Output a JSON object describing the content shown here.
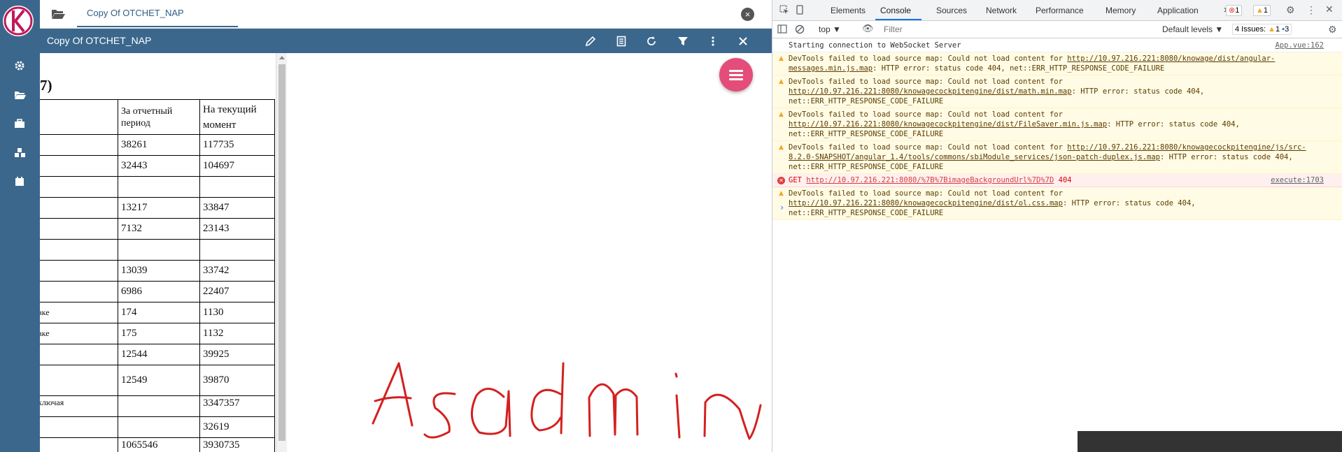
{
  "tab": {
    "label": "Copy Of OTCHET_NAP"
  },
  "toolbar": {
    "title": "Copy Of OTCHET_NAP"
  },
  "document": {
    "title_fragment": "7)",
    "table": {
      "headers": [
        "",
        "За отчетный период",
        "На текущий момент"
      ],
      "rows": [
        [
          "",
          "38261",
          "117735"
        ],
        [
          "",
          "32443",
          "104697"
        ],
        [
          "",
          "",
          ""
        ],
        [
          "",
          "13217",
          "33847"
        ],
        [
          "",
          "7132",
          "23143"
        ],
        [
          "",
          "",
          ""
        ],
        [
          "",
          "13039",
          "33742"
        ],
        [
          "",
          "6986",
          "22407"
        ],
        [
          "вке",
          "174",
          "1130"
        ],
        [
          "вке",
          "175",
          "1132"
        ],
        [
          "",
          "12544",
          "39925"
        ],
        [
          "",
          "12549",
          "39870"
        ],
        [
          "ключая",
          "",
          "3347357"
        ],
        [
          "",
          "",
          "32619"
        ],
        [
          "",
          "1065546",
          "3930735"
        ]
      ]
    },
    "handwriting": "Asadmin"
  },
  "devtools": {
    "tabs": [
      "Elements",
      "Console",
      "Sources",
      "Network",
      "Performance",
      "Memory",
      "Application"
    ],
    "active_tab": "Console",
    "more": "»",
    "error_badge": "1",
    "warning_badge": "1",
    "context": "top ▼",
    "filter_placeholder": "Filter",
    "levels": "Default levels ▼",
    "issues_label": "4 Issues:",
    "issues_warn": "1",
    "issues_info": "3",
    "messages": [
      {
        "type": "info",
        "text": "Starting connection to WebSocket Server",
        "source": "App.vue:162"
      },
      {
        "type": "warn",
        "text": "DevTools failed to load source map: Could not load content for ",
        "link": "http://10.97.216.221:8080/knowage/dist/angular-messages.min.js.map",
        "suffix": ": HTTP error: status code 404, net::ERR_HTTP_RESPONSE_CODE_FAILURE"
      },
      {
        "type": "warn",
        "text": "DevTools failed to load source map: Could not load content for ",
        "link": "http://10.97.216.221:8080/knowagecockpitengine/dist/math.min.map",
        "suffix": ": HTTP error: status code 404, net::ERR_HTTP_RESPONSE_CODE_FAILURE"
      },
      {
        "type": "warn",
        "text": "DevTools failed to load source map: Could not load content for ",
        "link": "http://10.97.216.221:8080/knowagecockpitengine/dist/FileSaver.min.js.map",
        "suffix": ": HTTP error: status code 404, net::ERR_HTTP_RESPONSE_CODE_FAILURE"
      },
      {
        "type": "warn",
        "text": "DevTools failed to load source map: Could not load content for ",
        "link": "http://10.97.216.221:8080/knowagecockpitengine/js/src-8.2.0-SNAPSHOT/angular_1.4/tools/commons/sbiModule_services/json-patch-duplex.js.map",
        "suffix": ": HTTP error: status code 404, net::ERR_HTTP_RESPONSE_CODE_FAILURE"
      },
      {
        "type": "err",
        "text": "GET ",
        "link": "http://10.97.216.221:8080/%7B%7BimageBackgroundUrl%7D%7D",
        "suffix": " 404",
        "source": "execute:1703"
      },
      {
        "type": "warn",
        "text": "DevTools failed to load source map: Could not load content for ",
        "link": "http://10.97.216.221:8080/knowagecockpitengine/dist/ol.css.map",
        "suffix": ": HTTP error: status code 404, net::ERR_HTTP_RESPONSE_CODE_FAILURE"
      }
    ],
    "prompt": "›"
  },
  "icons": {
    "nav": [
      "gear-icon",
      "folder-open-icon",
      "briefcase-icon",
      "cubes-icon",
      "calendar-icon"
    ],
    "toolbar": [
      "pencil-icon",
      "document-icon",
      "refresh-icon",
      "filter-icon",
      "more-vertical-icon",
      "close-icon"
    ]
  },
  "colors": {
    "primary": "#3b678c",
    "fab": "#e44d7a",
    "handwriting": "#d42020",
    "logo": "#c2185b"
  }
}
